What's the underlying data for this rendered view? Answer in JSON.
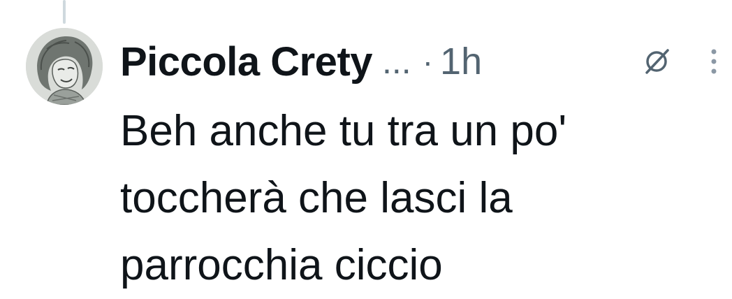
{
  "post": {
    "author_name": "Piccola Crety",
    "name_truncation": "...",
    "separator": "·",
    "time": "1h",
    "text_lines": [
      "Beh anche tu tra un po'",
      "toccherà che lasci la",
      "parrocchia ciccio"
    ]
  },
  "icons": {
    "avatar": "avatar-caricature",
    "grok": "grok-icon",
    "more": "more-options-icon"
  },
  "colors": {
    "text_primary": "#0f1419",
    "text_secondary": "#536471",
    "thread_line": "#cfd9de",
    "background": "#ffffff"
  }
}
